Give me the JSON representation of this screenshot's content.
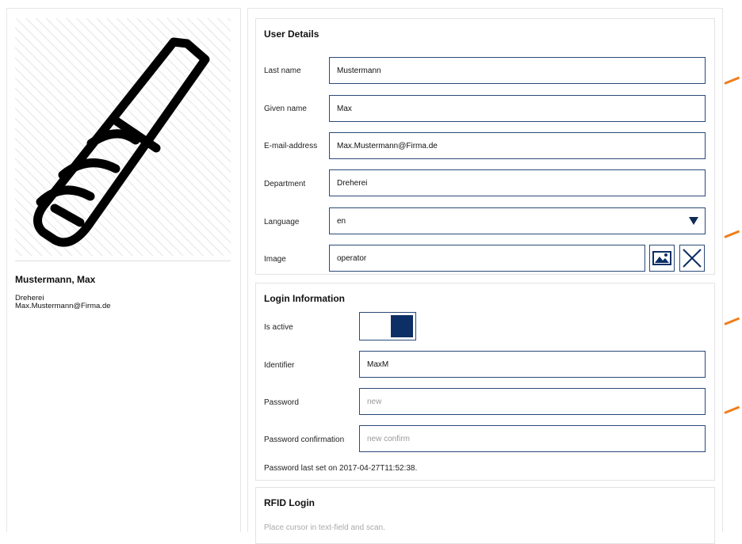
{
  "profile": {
    "name": "Mustermann, Max",
    "department": "Dreherei",
    "email": "Max.Mustermann@Firma.de",
    "avatar_icon": "tool-icon"
  },
  "user_details": {
    "title": "User Details",
    "last_name": {
      "label": "Last name",
      "value": "Mustermann"
    },
    "given_name": {
      "label": "Given name",
      "value": "Max"
    },
    "email": {
      "label": "E-mail-address",
      "value": "Max.Mustermann@Firma.de"
    },
    "department": {
      "label": "Department",
      "value": "Dreherei"
    },
    "language": {
      "label": "Language",
      "value": "en"
    },
    "image": {
      "label": "Image",
      "value": "operator",
      "pick_icon": "image-icon",
      "clear_icon": "close-icon"
    }
  },
  "login": {
    "title": "Login Information",
    "is_active": {
      "label": "Is active",
      "state": true
    },
    "identifier": {
      "label": "Identifier",
      "value": "MaxM"
    },
    "password": {
      "label": "Password",
      "placeholder": "new"
    },
    "password_confirm": {
      "label": "Password confirmation",
      "placeholder": "new confirm"
    },
    "last_set_note": "Password last set on 2017-04-27T11:52:38."
  },
  "rfid": {
    "title": "RFID Login",
    "hint": "Place cursor in text-field and scan."
  },
  "colors": {
    "field_border": "#2a4a78",
    "toggle_fill": "#0d2f66",
    "accent_marker": "#f07d1a"
  }
}
